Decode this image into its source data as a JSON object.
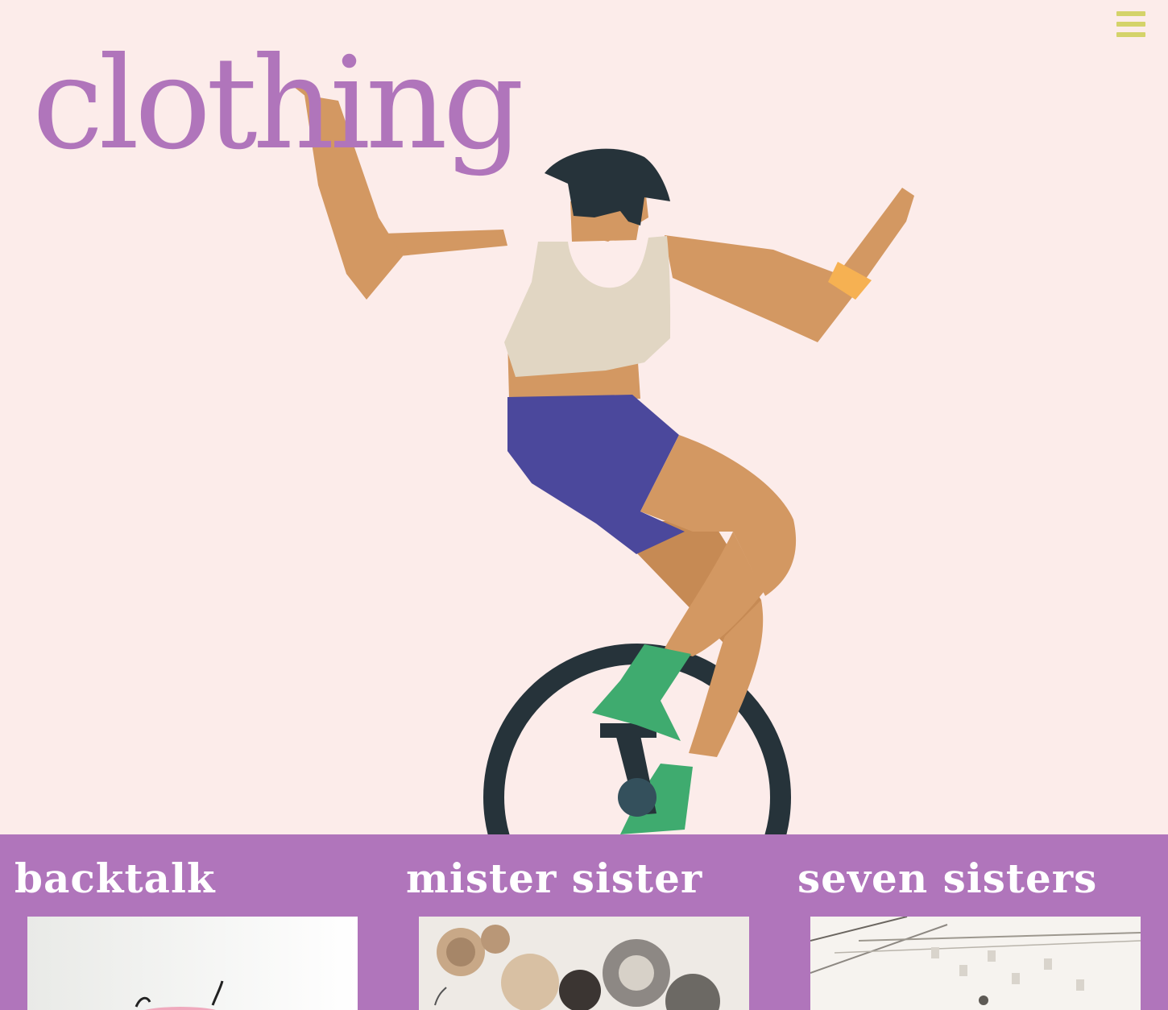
{
  "theme": {
    "hero_background": "#fcecea",
    "title_color": "#b075bb",
    "menu_icon_color": "#d4d36a",
    "stores_background": "#b075bb",
    "store_name_color": "#ffffff"
  },
  "header": {
    "title": "clothing",
    "menu_icon": "hamburger-menu-icon"
  },
  "hero": {
    "illustration": "person-riding-unicycle-illustration"
  },
  "stores": [
    {
      "name": "backtalk",
      "thumbnail": "store-photo-plant-vase"
    },
    {
      "name": "mister sister",
      "thumbnail": "store-photo-woven-baskets-wall"
    },
    {
      "name": "seven sisters",
      "thumbnail": "store-photo-shop-ceiling-lights"
    }
  ]
}
